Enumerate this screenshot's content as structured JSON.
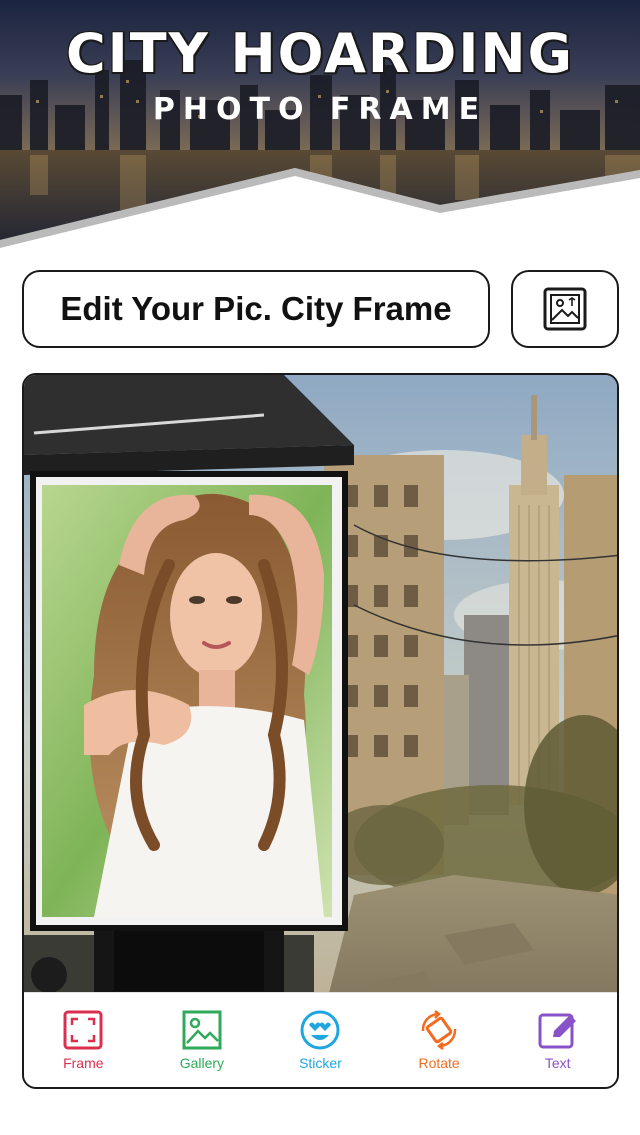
{
  "header": {
    "title": "CITY HOARDING",
    "subtitle": "PHOTO FRAME"
  },
  "edit_bar": {
    "label": "Edit Your Pic. City Frame"
  },
  "toolbar": {
    "items": [
      {
        "label": "Frame",
        "icon": "frame-icon",
        "color": "#d9304f"
      },
      {
        "label": "Gallery",
        "icon": "gallery-icon",
        "color": "#2faa5a"
      },
      {
        "label": "Sticker",
        "icon": "sticker-icon",
        "color": "#1fa6e0"
      },
      {
        "label": "Rotate",
        "icon": "rotate-icon",
        "color": "#f26b21"
      },
      {
        "label": "Text",
        "icon": "text-icon",
        "color": "#8a52c9"
      }
    ]
  }
}
